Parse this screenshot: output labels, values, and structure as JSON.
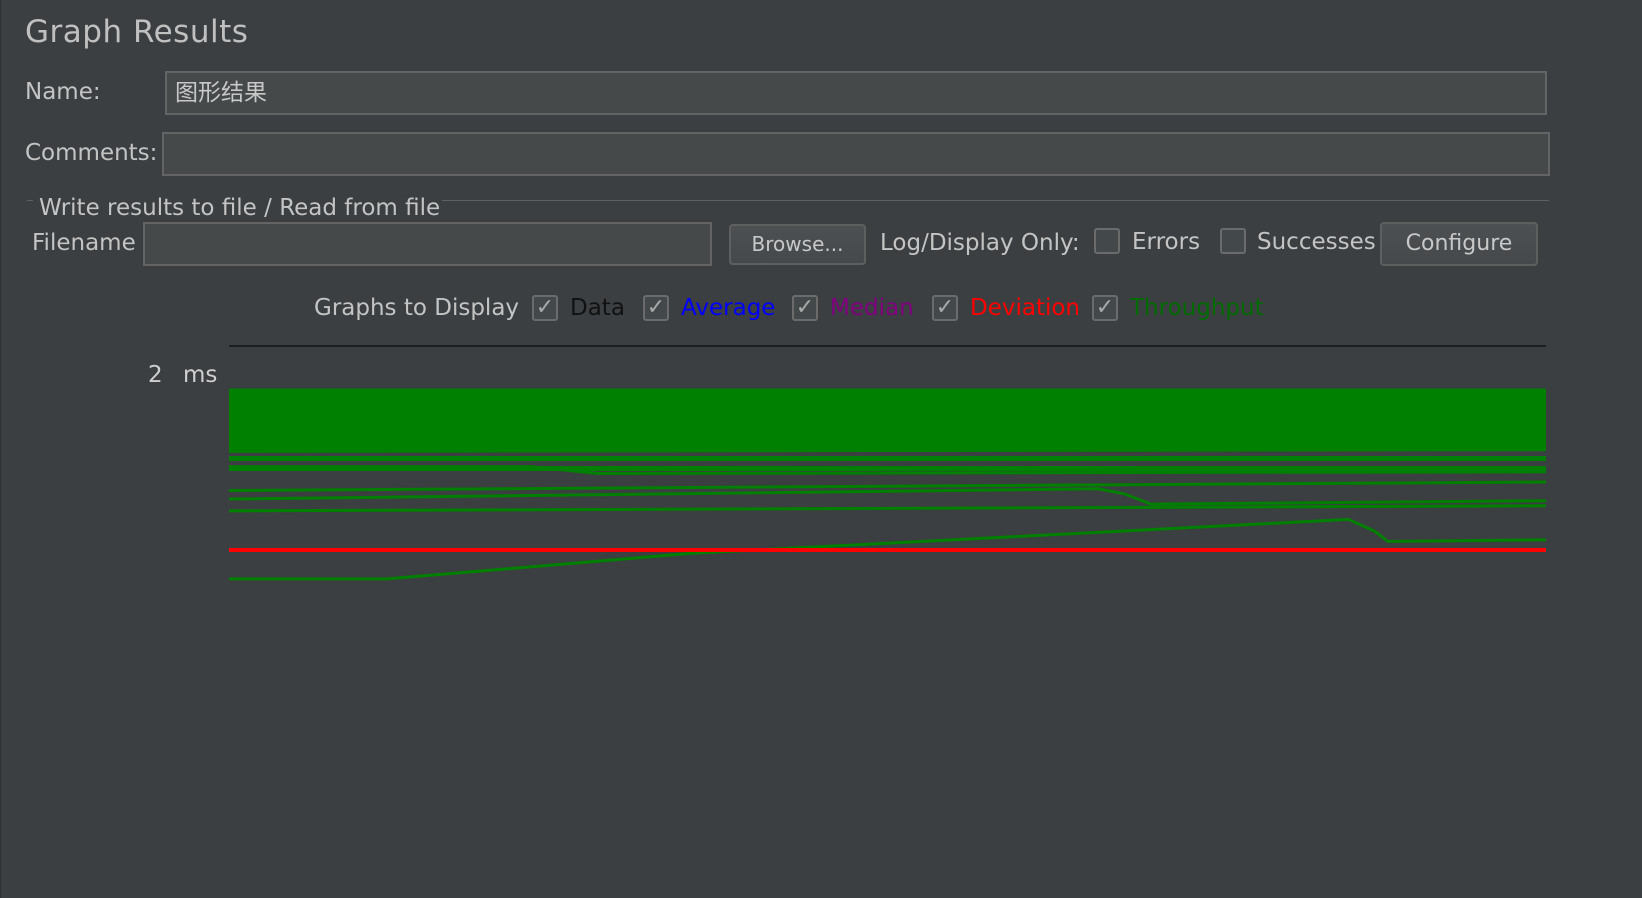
{
  "title": "Graph Results",
  "name_field": {
    "label": "Name:",
    "value": "图形结果"
  },
  "comments_field": {
    "label": "Comments:",
    "value": ""
  },
  "file_group": {
    "title": "Write results to file / Read from file",
    "filename_label": "Filename",
    "filename_value": "",
    "browse_label": "Browse...",
    "log_display_label": "Log/Display Only:",
    "errors_label": "Errors",
    "errors_checked": false,
    "successes_label": "Successes",
    "successes_checked": false,
    "configure_label": "Configure"
  },
  "graphs_to_display": {
    "label": "Graphs to Display",
    "options": [
      {
        "label": "Data",
        "checked": true,
        "color": "#111111"
      },
      {
        "label": "Average",
        "checked": true,
        "color": "#0000ff"
      },
      {
        "label": "Median",
        "checked": true,
        "color": "#800080"
      },
      {
        "label": "Deviation",
        "checked": true,
        "color": "#ff0000"
      },
      {
        "label": "Throughput",
        "checked": true,
        "color": "#006b00"
      }
    ]
  },
  "chart_data": {
    "type": "line",
    "y_max_label": "2",
    "y_unit": "ms",
    "grid": false,
    "colors": {
      "throughput": "#008000",
      "deviation": "#ff0000"
    },
    "x_range": [
      0,
      100
    ],
    "y_range": [
      0,
      2
    ],
    "series": [
      {
        "role": "throughput-band",
        "x": [
          0,
          40,
          79,
          79,
          100
        ],
        "y": [
          1.95,
          1.95,
          1.95,
          1.96,
          1.96
        ]
      },
      {
        "x": [
          0,
          100
        ],
        "y": [
          1.79,
          1.79
        ]
      },
      {
        "x": [
          0,
          100
        ],
        "y": [
          1.77,
          1.77
        ]
      },
      {
        "x": [
          0,
          100
        ],
        "y": [
          1.75,
          1.75
        ]
      },
      {
        "x": [
          0,
          100
        ],
        "y": [
          1.73,
          1.73
        ]
      },
      {
        "x": [
          0,
          100
        ],
        "y": [
          1.7,
          1.68
        ]
      },
      {
        "x": [
          0,
          60,
          62,
          100
        ],
        "y": [
          1.64,
          1.64,
          1.62,
          1.62
        ]
      },
      {
        "x": [
          0,
          100
        ],
        "y": [
          1.58,
          1.59
        ]
      },
      {
        "x": [
          0,
          23,
          28,
          100
        ],
        "y": [
          1.49,
          1.49,
          1.45,
          1.46
        ]
      },
      {
        "x": [
          0,
          100
        ],
        "y": [
          1.35,
          1.4
        ]
      },
      {
        "x": [
          0,
          66,
          68,
          70,
          100
        ],
        "y": [
          1.3,
          1.36,
          1.33,
          1.27,
          1.29
        ]
      },
      {
        "x": [
          0,
          100
        ],
        "y": [
          1.23,
          1.26
        ]
      },
      {
        "x": [
          0,
          12,
          35,
          60,
          85,
          87,
          88,
          100
        ],
        "y": [
          0.83,
          0.83,
          0.98,
          1.08,
          1.18,
          1.11,
          1.05,
          1.06
        ]
      }
    ],
    "deviation": {
      "x": [
        0,
        100
      ],
      "y": [
        1.0,
        1.0
      ]
    }
  }
}
